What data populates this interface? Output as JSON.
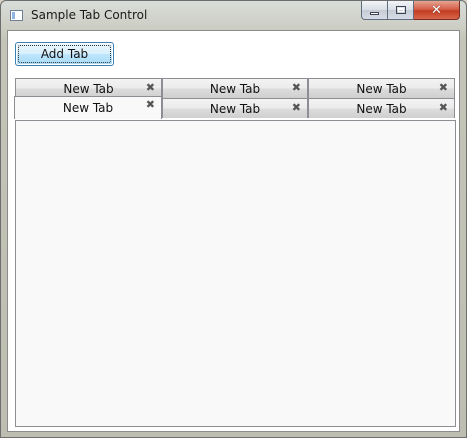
{
  "window": {
    "title": "Sample Tab Control",
    "caption_buttons": {
      "minimize": "minimize-icon",
      "maximize": "maximize-icon",
      "close": "close-icon"
    }
  },
  "toolbar": {
    "add_tab_label": "Add Tab"
  },
  "tabs": {
    "close_glyph": "✖",
    "row1": [
      {
        "label": "New Tab",
        "selected": false
      },
      {
        "label": "New Tab",
        "selected": false
      },
      {
        "label": "New Tab",
        "selected": false
      }
    ],
    "row2": [
      {
        "label": "New Tab",
        "selected": true
      },
      {
        "label": "New Tab",
        "selected": false
      },
      {
        "label": "New Tab",
        "selected": false
      }
    ]
  },
  "colors": {
    "button_accent": "#3c7fb1",
    "close_button": "#c33d22",
    "panel_background": "#f9f9f9"
  }
}
